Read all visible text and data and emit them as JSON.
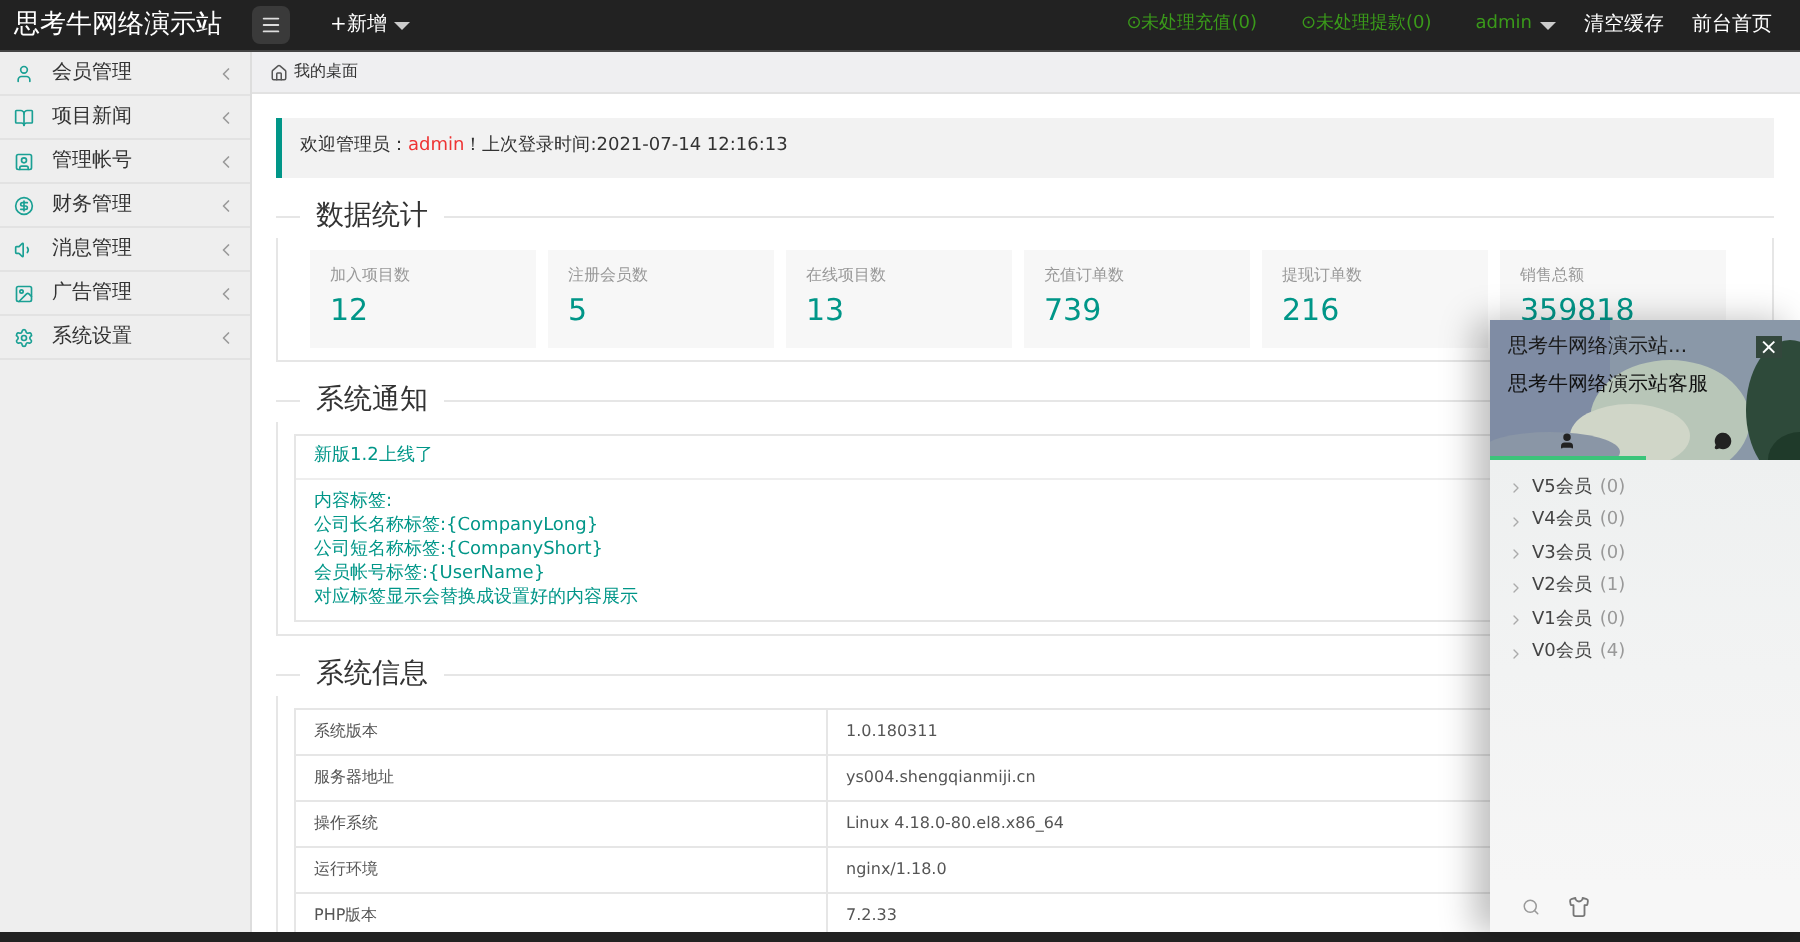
{
  "topbar": {
    "logo": "思考牛网络演示站",
    "add": "+新增",
    "links": [
      {
        "kind": "alert",
        "text": "⊙未处理充值(0)"
      },
      {
        "kind": "alert",
        "text": "⊙未处理提款(0)"
      },
      {
        "kind": "user",
        "text": "admin"
      },
      {
        "kind": "plain",
        "text": "清空缓存"
      },
      {
        "kind": "plain",
        "text": "前台首页"
      }
    ]
  },
  "sidebar": {
    "items": [
      {
        "label": "会员管理"
      },
      {
        "label": "项目新闻"
      },
      {
        "label": "管理帐号"
      },
      {
        "label": "财务管理"
      },
      {
        "label": "消息管理"
      },
      {
        "label": "广告管理"
      },
      {
        "label": "系统设置"
      }
    ]
  },
  "breadcrumb": "我的桌面",
  "welcome": {
    "prefix": "欢迎管理员：",
    "user": "admin",
    "suffix": "！上次登录时间:2021-07-14 12:16:13"
  },
  "stats": {
    "title": "数据统计",
    "cards": [
      {
        "label": "加入项目数",
        "value": "12"
      },
      {
        "label": "注册会员数",
        "value": "5"
      },
      {
        "label": "在线项目数",
        "value": "13"
      },
      {
        "label": "充值订单数",
        "value": "739"
      },
      {
        "label": "提现订单数",
        "value": "216"
      },
      {
        "label": "销售总额",
        "value": "359818"
      }
    ]
  },
  "notice": {
    "title": "系统通知",
    "headline": "新版1.2上线了",
    "lines": [
      "内容标签:",
      "公司长名称标签:{CompanyLong}",
      "公司短名称标签:{CompanyShort}",
      "会员帐号标签:{UserName}",
      "对应标签显示会替换成设置好的内容展示"
    ]
  },
  "info": {
    "title": "系统信息",
    "rows": [
      [
        "系统版本",
        "1.0.180311"
      ],
      [
        "服务器地址",
        "ys004.shengqianmiji.cn"
      ],
      [
        "操作系统",
        "Linux 4.18.0-80.el8.x86_64"
      ],
      [
        "运行环境",
        "nginx/1.18.0"
      ],
      [
        "PHP版本",
        "7.2.33"
      ]
    ]
  },
  "chat": {
    "title": "思考牛网络演示站...",
    "close": "×",
    "subtitle": "思考牛网络演示站客服",
    "tabs": [
      {
        "selected": true
      },
      {
        "selected": false
      }
    ],
    "groups": [
      {
        "name": "V5会员",
        "count": "(0)"
      },
      {
        "name": "V4会员",
        "count": "(0)"
      },
      {
        "name": "V3会员",
        "count": "(0)"
      },
      {
        "name": "V2会员",
        "count": "(1)"
      },
      {
        "name": "V1会员",
        "count": "(0)"
      },
      {
        "name": "V0会员",
        "count": "(4)"
      }
    ]
  }
}
